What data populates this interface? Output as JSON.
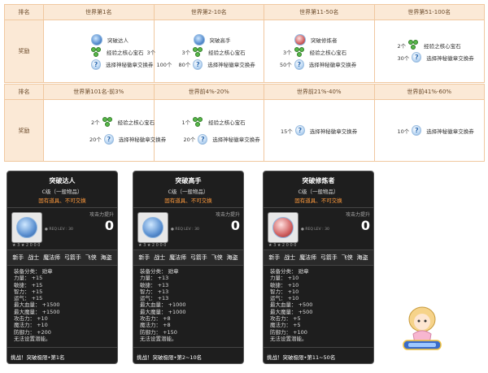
{
  "table1": {
    "headers": [
      "排名",
      "世界第1名",
      "世界第2-10名",
      "世界第11-50名",
      "世界第51-100名"
    ],
    "row_label": "奖励",
    "cells": [
      {
        "medal": "突破达人",
        "gem_qty": "3个",
        "ticket_qty": "100个"
      },
      {
        "medal": "突破高手",
        "gem_qty": "3个",
        "ticket_qty": "80个"
      },
      {
        "medal": "突破修炼者",
        "gem_qty": "3个",
        "ticket_qty": "50个"
      },
      {
        "gem_qty": "2个",
        "ticket_qty": "30个"
      }
    ],
    "gem_name": "经验之核心宝石",
    "ticket_name": "选择神秘徽章交换券"
  },
  "table2": {
    "headers": [
      "排名",
      "世界第101名-前3%",
      "世界前4%-20%",
      "世界前21%-40%",
      "世界前41%-60%"
    ],
    "row_label": "奖励",
    "cells": [
      {
        "gem_qty": "2个",
        "ticket_qty": "20个"
      },
      {
        "gem_qty": "1个",
        "ticket_qty": "20个"
      },
      {
        "ticket_qty": "15个"
      },
      {
        "ticket_qty": "10个"
      }
    ]
  },
  "cards": [
    {
      "title": "突破达人",
      "grade": "C级（一般物品）",
      "untradable": "固有道具、不可交换",
      "atk_label": "攻击力提升",
      "atk_val": "0",
      "req": "● REQ LEV : 30",
      "stars": "★ 3 ★ 2 0 0 0",
      "jobs": [
        "新手",
        "战士",
        "魔法师",
        "弓箭手",
        "飞侠",
        "海盗"
      ],
      "stats": [
        "装备分类：  勋章",
        "力量：  +15",
        "敏捷：  +15",
        "智力：  +15",
        "运气：  +15",
        "最大血量：  +1500",
        "最大魔量：  +1500",
        "攻击力：  +10",
        "魔法力：  +10",
        "防御力：  +200",
        "无法设置潜能。"
      ],
      "footer": "挑战！突破极限•第1名"
    },
    {
      "title": "突破高手",
      "grade": "C级（一般物品）",
      "untradable": "固有道具、不可交换",
      "atk_label": "攻击力提升",
      "atk_val": "0",
      "req": "● REQ LEV : 30",
      "stars": "★ 3 ★ 2 0 0 0",
      "jobs": [
        "新手",
        "战士",
        "魔法师",
        "弓箭手",
        "飞侠",
        "海盗"
      ],
      "stats": [
        "装备分类：  勋章",
        "力量：  +13",
        "敏捷：  +13",
        "智力：  +13",
        "运气：  +13",
        "最大血量：  +1000",
        "最大魔量：  +1000",
        "攻击力：  +8",
        "魔法力：  +8",
        "防御力：  +150",
        "无法设置潜能。"
      ],
      "footer": "挑战！突破极限•第2~10名"
    },
    {
      "title": "突破修炼者",
      "grade": "C级（一般物品）",
      "untradable": "固有道具、不可交换",
      "atk_label": "攻击力提升",
      "atk_val": "0",
      "req": "● REQ LEV : 30",
      "stars": "★ 3 ★ 2 0 0 0",
      "jobs": [
        "新手",
        "战士",
        "魔法师",
        "弓箭手",
        "飞侠",
        "海盗"
      ],
      "stats": [
        "装备分类：  勋章",
        "力量：  +10",
        "敏捷：  +10",
        "智力：  +10",
        "运气：  +10",
        "最大血量：  +500",
        "最大魔量：  +500",
        "攻击力：  +5",
        "魔法力：  +5",
        "防御力：  +100",
        "无法设置潜能。"
      ],
      "footer": "挑战！突破极限•第11~50名"
    }
  ]
}
